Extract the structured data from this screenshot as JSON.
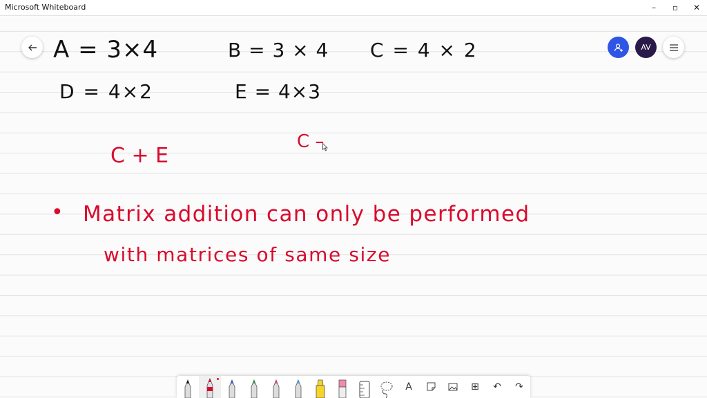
{
  "window": {
    "title": "Microsoft Whiteboard",
    "controls": {
      "minimize": "–",
      "maximize": "▫",
      "close": "✕"
    }
  },
  "header": {
    "back_icon": "arrow-left-icon",
    "share_icon": "person-add-icon",
    "avatar_initials": "AV",
    "menu_icon": "hamburger-menu-icon"
  },
  "board": {
    "ink_color_black": "#111111",
    "ink_color_red": "#d90a2e",
    "line1": {
      "a": "A  =  3×4",
      "b": "B  = 3 × 4",
      "c": "C =  4 × 2"
    },
    "line2": {
      "d": "D  =  4×2",
      "e": "E = 4×3"
    },
    "expr1": "C + E",
    "expr2": "C –",
    "bullet": "•",
    "note_line1": "Matrix  addition  can  only  be  performed",
    "note_line2": "with  matrices  of  same  size"
  },
  "toolbar": {
    "tools": [
      "black-pen-icon",
      "red-pen-icon",
      "blue-pen-icon",
      "green-pen-icon",
      "red-marker-icon",
      "light-blue-pen-icon",
      "yellow-highlighter-icon",
      "eraser-icon",
      "ruler-icon",
      "lasso-select-icon",
      "text-icon",
      "sticky-note-icon",
      "image-icon",
      "add-icon",
      "undo-icon",
      "redo-icon"
    ],
    "text_tool_label": "A",
    "add_label": "⊞",
    "undo_label": "↶",
    "redo_label": "↷"
  }
}
